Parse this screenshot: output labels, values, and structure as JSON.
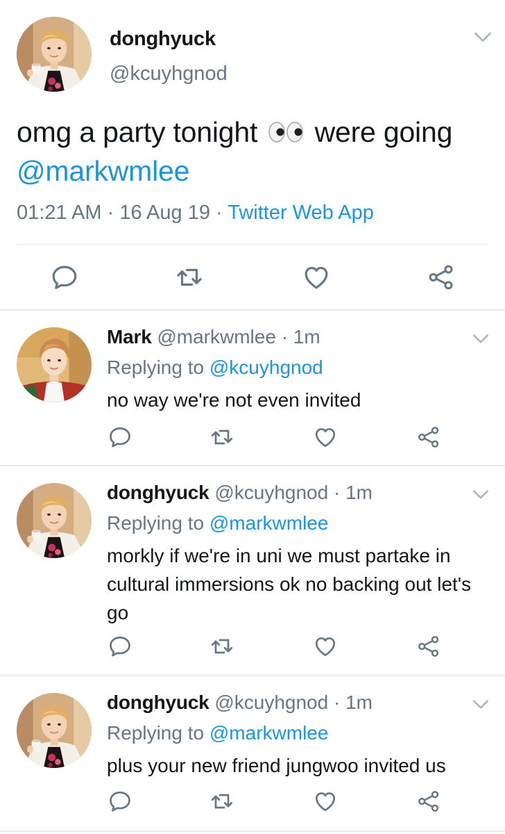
{
  "main_tweet": {
    "name": "donghyuck",
    "handle": "@kcuyhgnod",
    "text_before": "omg a party tonight",
    "emoji": "eyes-emoji",
    "text_after": "were going",
    "mention": "@markwmlee",
    "time": "01:21 AM",
    "date": "16 Aug 19",
    "source": "Twitter Web App",
    "separator": "·",
    "actions": [
      "reply-icon",
      "retweet-icon",
      "like-icon",
      "share-icon"
    ]
  },
  "replies": [
    {
      "name": "Mark",
      "handle": "@markwmlee",
      "separator": "·",
      "time": "1m",
      "replying_label": "Replying to",
      "replying_to": "@kcuyhgnod",
      "text": "no way we're not even invited"
    },
    {
      "name": "donghyuck",
      "handle": "@kcuyhgnod",
      "separator": "·",
      "time": "1m",
      "replying_label": "Replying to",
      "replying_to": "@markwmlee",
      "text": "morkly if we're in uni we must partake in cultural immersions ok no backing out let's go"
    },
    {
      "name": "donghyuck",
      "handle": "@kcuyhgnod",
      "separator": "·",
      "time": "1m",
      "replying_label": "Replying to",
      "replying_to": "@markwmlee",
      "text": "plus your new friend jungwoo invited us"
    }
  ],
  "colors": {
    "link": "#1b95e0",
    "secondary_text": "#657786",
    "icon": "#657786",
    "divider": "#e6ecf0"
  }
}
